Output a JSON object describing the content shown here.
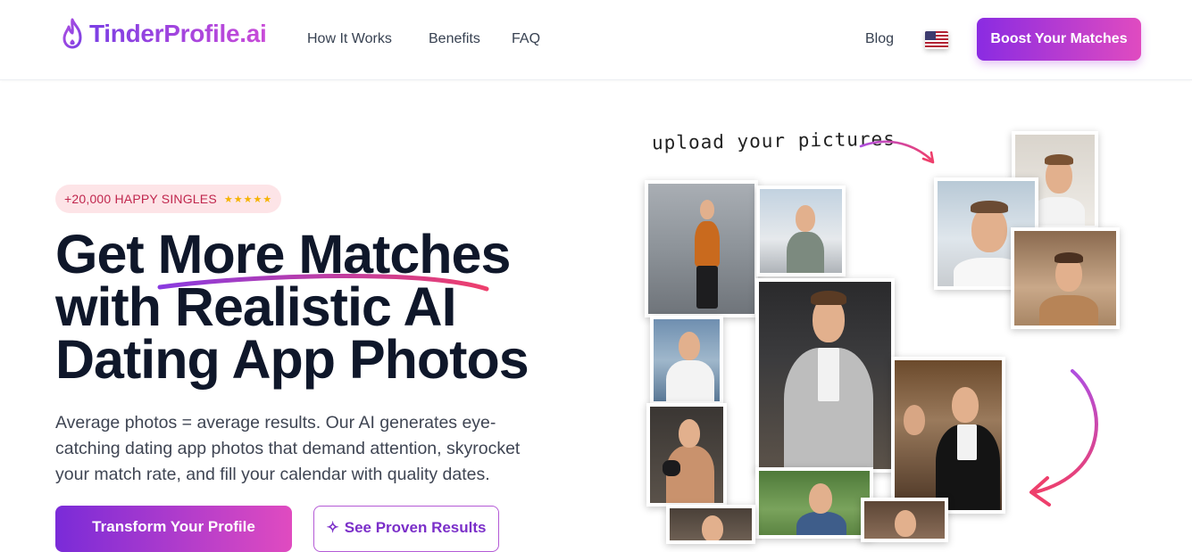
{
  "nav": {
    "logo_text": "TinderProfile.ai",
    "links": [
      "How It Works",
      "Benefits",
      "FAQ"
    ],
    "blog": "Blog",
    "cta": "Boost Your Matches"
  },
  "hero": {
    "badge_text": "+20,000 HAPPY SINGLES",
    "badge_stars": "★★★★★",
    "headline_line1": "Get More Matches",
    "headline_line2": "with Realistic AI",
    "headline_line3": "Dating App Photos",
    "subtext": "Average photos = average results. Our AI generates eye-catching dating app photos that demand attention, skyrocket your match rate, and fill your calendar with quality dates.",
    "cta_primary": "Transform Your Profile",
    "cta_secondary": "See Proven Results"
  },
  "collage": {
    "caption": "upload your pictures"
  },
  "colors": {
    "brand_purple": "#8a2be2",
    "brand_pink": "#e04bc0",
    "headline": "#0f172a",
    "badge_bg": "#fde4e7",
    "badge_text": "#c0264d"
  }
}
